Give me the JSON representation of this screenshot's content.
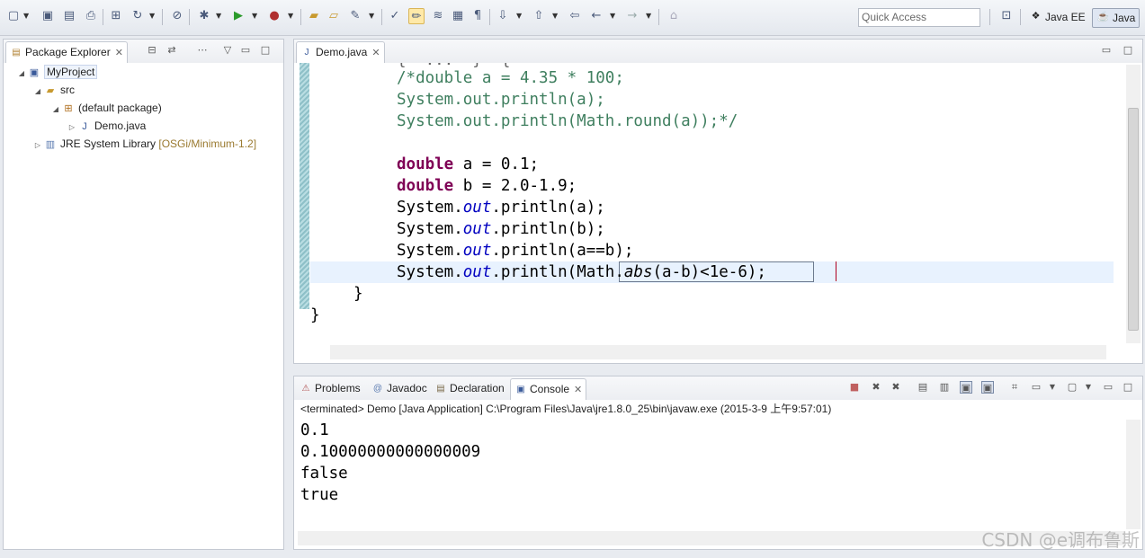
{
  "toolbar": {
    "quick_access_placeholder": "Quick Access",
    "perspectives": [
      {
        "label": "Java EE",
        "icon": "java-ee-perspective-icon"
      },
      {
        "label": "Java",
        "icon": "java-perspective-icon"
      }
    ]
  },
  "package_explorer": {
    "tab_label": "Package Explorer",
    "tree": {
      "project": "MyProject",
      "src": "src",
      "package": "(default package)",
      "file": "Demo.java",
      "library": "JRE System Library",
      "library_decoration": "[OSGi/Minimum-1.2]"
    }
  },
  "editor": {
    "tab_label": "Demo.java",
    "partial_top": "{  ...  }  {",
    "lines": {
      "l1": "/*double a = 4.35 * 100;",
      "l2": "System.out.println(a);",
      "l3": "System.out.println(Math.round(a));*/",
      "l5_kw": "double",
      "l5_rest": " a = 0.1;",
      "l6_kw": "double",
      "l6_rest": " b = 2.0-1.9;",
      "sys": "System.",
      "out": "out",
      "p7": ".println(a);",
      "p8": ".println(b);",
      "p9": ".println(a==b);",
      "p10a": ".println(",
      "p10math": "Math.",
      "p10abs": "abs",
      "p10b": "(a-b)<1e-6",
      "p10c": ");",
      "close1": "}",
      "close2": "}"
    }
  },
  "console_panel": {
    "tabs": [
      "Problems",
      "Javadoc",
      "Declaration",
      "Console"
    ],
    "terminated_line": "<terminated> Demo [Java Application] C:\\Program Files\\Java\\jre1.8.0_25\\bin\\javaw.exe (2015-3-9 上午9:57:01)",
    "output": [
      "0.1",
      "0.10000000000000009",
      "false",
      "true"
    ]
  },
  "watermark": "CSDN @e调布鲁斯"
}
